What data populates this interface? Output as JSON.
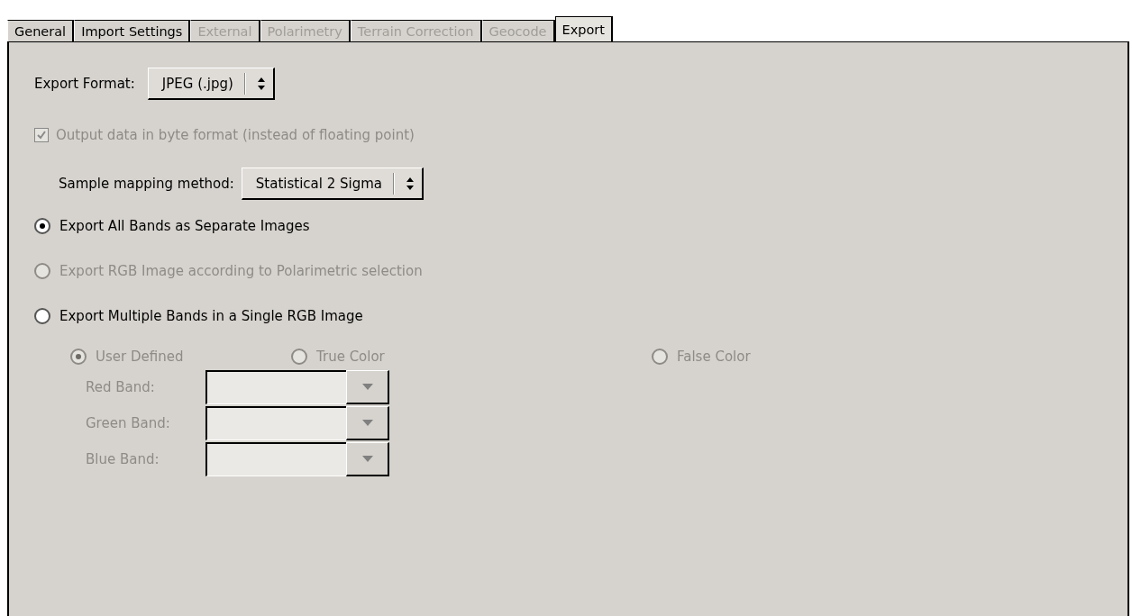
{
  "tabs": [
    {
      "label": "General",
      "selected": false,
      "disabled": false
    },
    {
      "label": "Import Settings",
      "selected": false,
      "disabled": false
    },
    {
      "label": "External",
      "selected": false,
      "disabled": true
    },
    {
      "label": "Polarimetry",
      "selected": false,
      "disabled": true
    },
    {
      "label": "Terrain Correction",
      "selected": false,
      "disabled": true
    },
    {
      "label": "Geocode",
      "selected": false,
      "disabled": true
    },
    {
      "label": "Export",
      "selected": true,
      "disabled": false
    }
  ],
  "export_format": {
    "label": "Export Format:",
    "value": "JPEG (.jpg)"
  },
  "byte_format": {
    "label": "Output data in byte format (instead of floating point)",
    "checked": true,
    "disabled": true
  },
  "sample_mapping": {
    "label": "Sample mapping method:",
    "value": "Statistical 2 Sigma"
  },
  "export_modes": [
    {
      "label": "Export All Bands as Separate Images",
      "selected": true,
      "disabled": false
    },
    {
      "label": "Export RGB Image according to Polarimetric selection",
      "selected": false,
      "disabled": true
    },
    {
      "label": "Export Multiple Bands in a Single RGB Image",
      "selected": false,
      "disabled": false
    }
  ],
  "color_modes": [
    {
      "label": "User Defined",
      "selected": true,
      "disabled": true
    },
    {
      "label": "True Color",
      "selected": false,
      "disabled": true
    },
    {
      "label": "False Color",
      "selected": false,
      "disabled": true
    }
  ],
  "bands": [
    {
      "label": "Red Band:",
      "disabled": true
    },
    {
      "label": "Green Band:",
      "disabled": true
    },
    {
      "label": "Blue Band:",
      "disabled": true
    }
  ]
}
